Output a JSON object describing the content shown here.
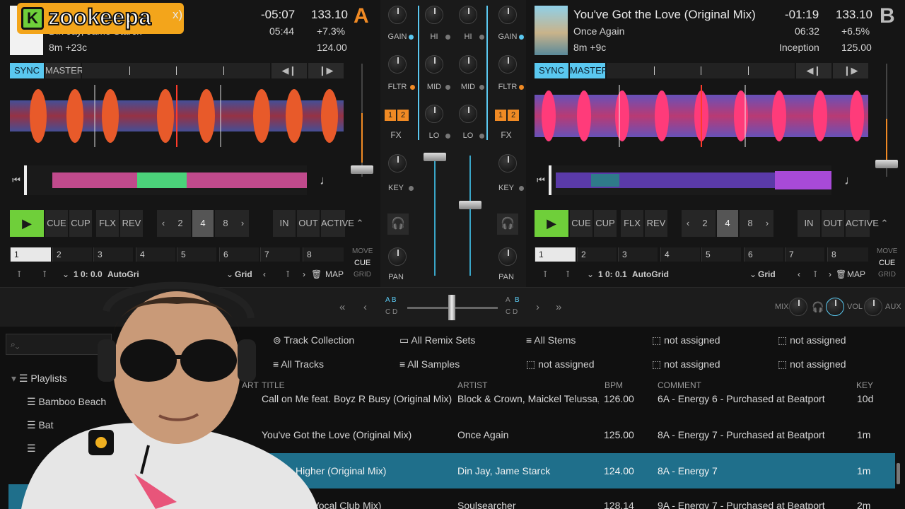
{
  "overlay": {
    "logo_text": "zookeepa",
    "logo_badge": "K",
    "channel_partial": "x)"
  },
  "deckA": {
    "letter": "A",
    "artist": "Din Jay, Jame Starck",
    "key_info": "8m +23c",
    "remaining": "-05:07",
    "total": "05:44",
    "bpm": "133.10",
    "pitch": "+7.3%",
    "orig_bpm": "124.00",
    "sync": "SYNC",
    "master": "MASTER",
    "play": "▶",
    "cue": "CUE",
    "cup": "CUP",
    "flx": "FLX",
    "rev": "REV",
    "loop_sizes": [
      "2",
      "4",
      "8"
    ],
    "in": "IN",
    "out": "OUT",
    "active": "ACTIVE",
    "hotcues": [
      "1",
      "2",
      "3",
      "4",
      "5",
      "6",
      "7",
      "8"
    ],
    "move_labels": [
      "MOVE",
      "CUE",
      "GRID"
    ],
    "position": "1 0: 0.0",
    "autogrid": "AutoGri",
    "grid": "Grid",
    "map": "MAP"
  },
  "deckB": {
    "letter": "B",
    "title": "You've Got the Love (Original Mix)",
    "artist": "Once Again",
    "key_info": "8m +9c",
    "remaining": "-01:19",
    "total": "06:32",
    "bpm": "133.10",
    "pitch": "+6.5%",
    "album": "Inception",
    "orig_bpm": "125.00",
    "sync": "SYNC",
    "master": "MASTER",
    "play": "▶",
    "cue": "CUE",
    "cup": "CUP",
    "flx": "FLX",
    "rev": "REV",
    "loop_sizes": [
      "2",
      "4",
      "8"
    ],
    "in": "IN",
    "out": "OUT",
    "active": "ACTIVE",
    "hotcues": [
      "1",
      "2",
      "3",
      "4",
      "5",
      "6",
      "7",
      "8"
    ],
    "move_labels": [
      "MOVE",
      "CUE",
      "GRID"
    ],
    "position": "1 0: 0.1",
    "autogrid": "AutoGrid",
    "grid": "Grid",
    "map": "MAP"
  },
  "mixer": {
    "gain": "GAIN",
    "fltr": "FLTR",
    "fx": "FX",
    "key": "KEY",
    "pan": "PAN",
    "hi": "HI",
    "mid": "MID",
    "lo": "LO",
    "fx1": "1",
    "fx2": "2"
  },
  "crossfader": {
    "left_ab": "A  B",
    "left_cd": "C  D",
    "right_a": "A",
    "right_b": "B",
    "right_cd": "C  D",
    "mix": "MIX",
    "vol": "VOL",
    "aux": "AUX"
  },
  "browser": {
    "favorites": [
      "Track Collection",
      "All Remix Sets",
      "All Stems",
      "not assigned",
      "not assigned",
      "All Tracks",
      "All Samples",
      "not assigned",
      "not assigned",
      "not assigned"
    ],
    "sidebar": {
      "root": "Playlists",
      "items": [
        "Bamboo Beach",
        "Bat"
      ]
    },
    "columns": [
      "ART",
      "TITLE",
      "ARTIST",
      "BPM",
      "COMMENT",
      "KEY"
    ],
    "rows": [
      {
        "title": "Call on Me feat. Boyz R Busy (Original Mix)",
        "artist": "Block & Crown, Maickel Telussa, B~",
        "bpm": "126.00",
        "comment": "6A - Energy 6 - Purchased at Beatport",
        "key": "10d"
      },
      {
        "title": "You've Got the Love (Original Mix)",
        "artist": "Once Again",
        "bpm": "125.00",
        "comment": "8A - Energy 7 - Purchased at Beatport",
        "key": "1m"
      },
      {
        "title": "Higher (Original Mix)",
        "artist": "Din Jay, Jame Starck",
        "bpm": "124.00",
        "comment": "8A - Energy 7",
        "key": "1m"
      },
      {
        "title": "gh (Vocal Club Mix)",
        "artist": "Soulsearcher",
        "bpm": "128.14",
        "comment": "9A - Energy 7 - Purchased at Beatport",
        "key": "2m"
      }
    ]
  },
  "colors": {
    "accent": "#5ac8f0",
    "deck_letter": "#f08a24",
    "play": "#6fcf3a",
    "selected_row": "#1f6f8b"
  }
}
